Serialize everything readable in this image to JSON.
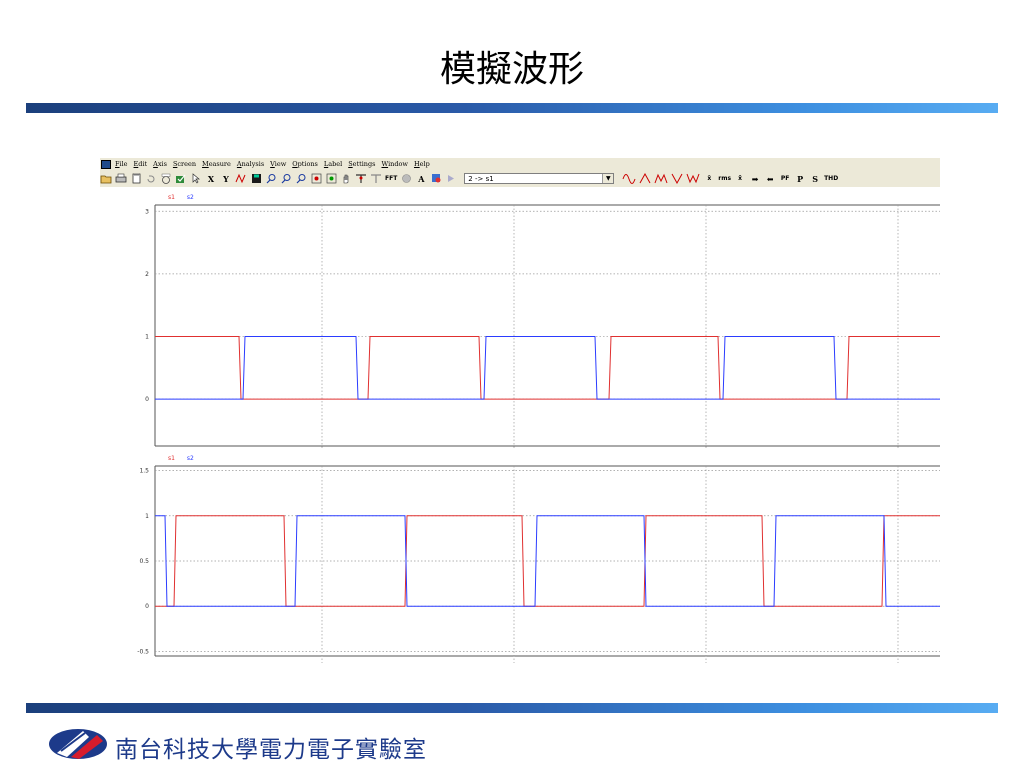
{
  "slide": {
    "title": "模擬波形",
    "footer": "南台科技大學電力電子實驗室",
    "band_color_start": "#1b3f7c",
    "band_color_end": "#58acf2"
  },
  "menu": [
    "File",
    "Edit",
    "Axis",
    "Screen",
    "Measure",
    "Analysis",
    "View",
    "Options",
    "Label",
    "Settings",
    "Window",
    "Help"
  ],
  "toolbar": {
    "open_icon": "folder-open-icon",
    "print_icon": "print-icon",
    "x_label": "X",
    "y_label": "Y",
    "fft_label": "FFT",
    "a_label": "A",
    "selector_value": "2 -> s1",
    "mean_label": "x̄",
    "rms_label": "rms",
    "avg_label": "x̄̄",
    "pf_label": "PF",
    "p_label": "P",
    "s_label": "S",
    "thd_label": "THD"
  },
  "colors": {
    "s1": "#e03030",
    "s2": "#2b3cff"
  },
  "chart_data": [
    {
      "type": "line",
      "ylim": [
        -0.75,
        3.1
      ],
      "yticks": [
        "3",
        "2",
        "1",
        "0"
      ],
      "legend": [
        "s1",
        "s2"
      ],
      "grid": "dotted",
      "series": [
        {
          "name": "s1",
          "color": "#e03030",
          "x": [
            0,
            84,
            86,
            213,
            215,
            324,
            326,
            454,
            456,
            563,
            565,
            692,
            694,
            785
          ],
          "values": [
            1,
            1,
            0,
            0,
            1,
            1,
            0,
            0,
            1,
            1,
            0,
            0,
            1,
            1
          ]
        },
        {
          "name": "s2",
          "color": "#2b3cff",
          "x": [
            0,
            88,
            90,
            201,
            203,
            329,
            331,
            440,
            442,
            568,
            570,
            679,
            681,
            785
          ],
          "values": [
            0,
            0,
            1,
            1,
            0,
            0,
            1,
            1,
            0,
            0,
            1,
            1,
            0,
            0
          ]
        }
      ]
    },
    {
      "type": "line",
      "ylim": [
        -0.55,
        1.55
      ],
      "yticks": [
        "1.5",
        "1",
        "0.5",
        "0",
        "-0.5"
      ],
      "legend": [
        "s1",
        "s2"
      ],
      "grid": "dotted",
      "series": [
        {
          "name": "s1",
          "color": "#e03030",
          "x": [
            0,
            19,
            21,
            129,
            131,
            250,
            252,
            367,
            369,
            489,
            491,
            607,
            609,
            727,
            729,
            740,
            785
          ],
          "values": [
            0,
            0,
            1,
            1,
            0,
            0,
            1,
            1,
            0,
            0,
            1,
            1,
            0,
            0,
            1,
            1,
            1
          ]
        },
        {
          "name": "s2",
          "color": "#2b3cff",
          "x": [
            0,
            10,
            12,
            140,
            142,
            250,
            252,
            380,
            382,
            489,
            491,
            619,
            621,
            729,
            731,
            785
          ],
          "values": [
            1,
            1,
            0,
            0,
            1,
            1,
            0,
            0,
            1,
            1,
            0,
            0,
            1,
            1,
            0,
            0
          ]
        }
      ]
    }
  ]
}
